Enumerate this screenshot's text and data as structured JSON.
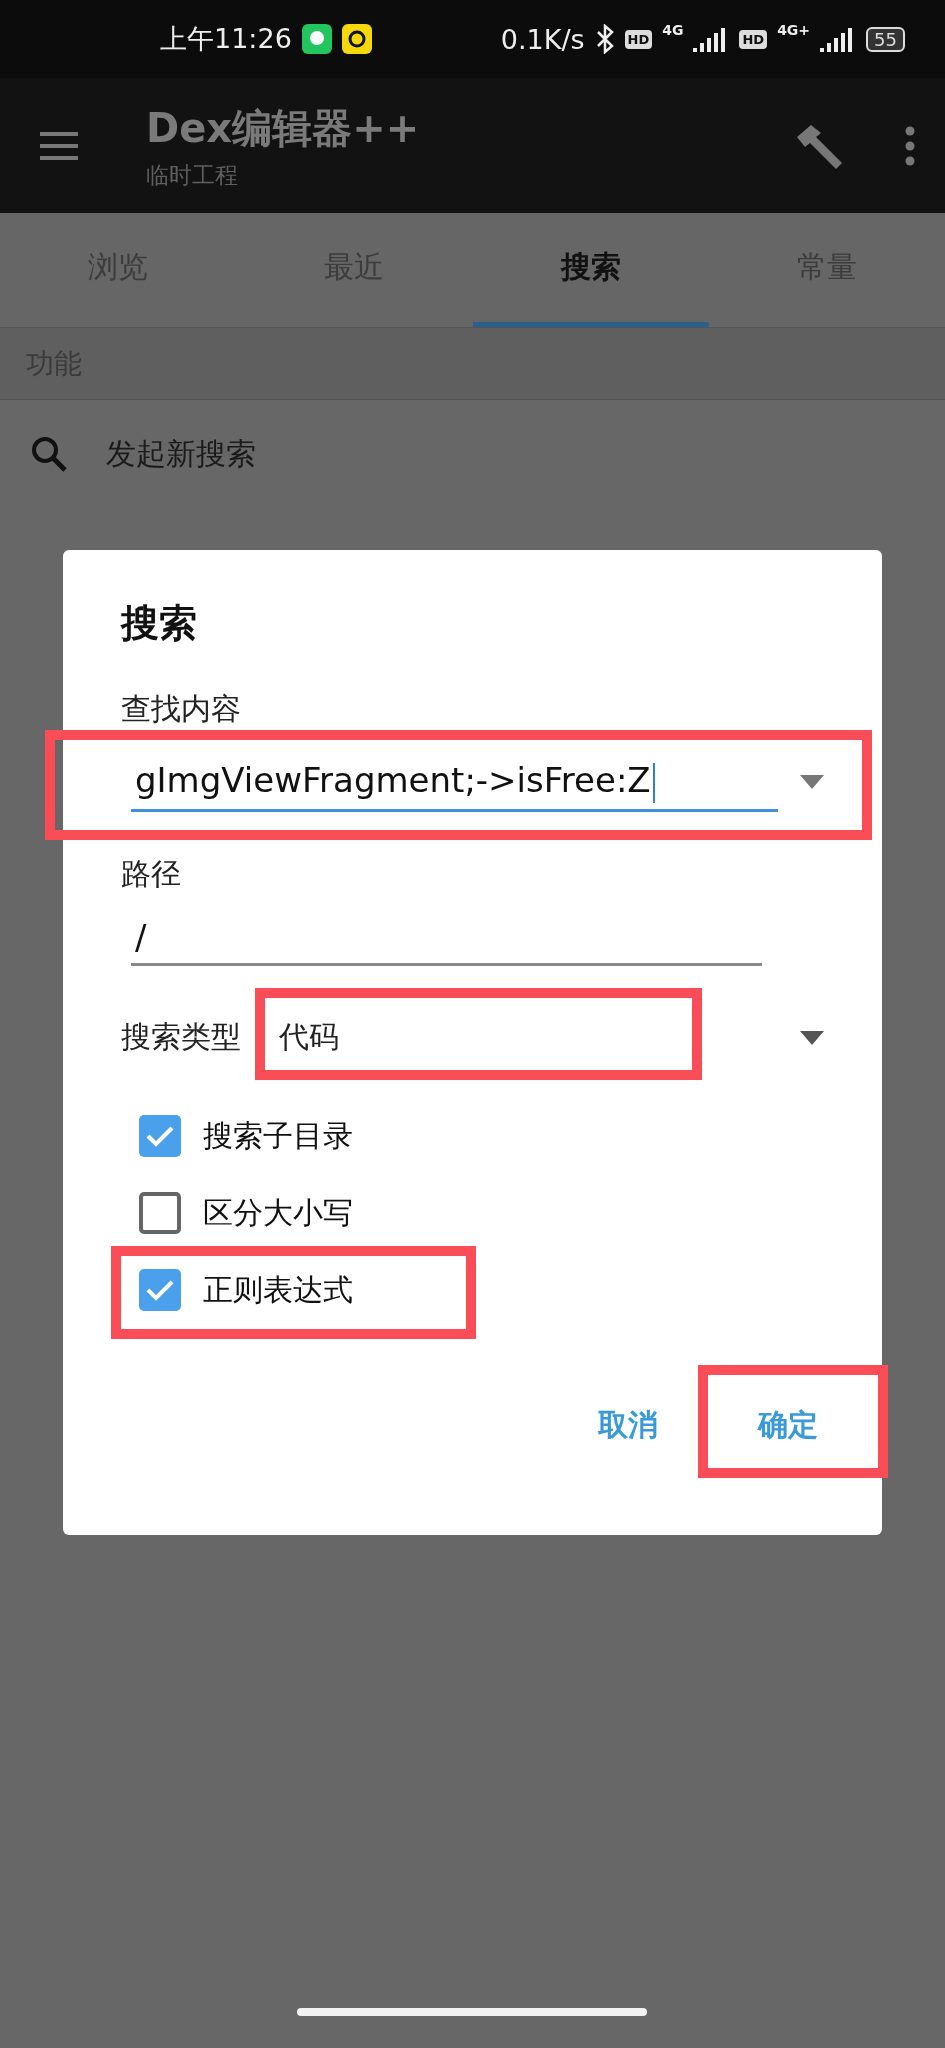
{
  "status_bar": {
    "time": "上午11:26",
    "speed": "0.1K/s",
    "sim_1": {
      "hd": "HD",
      "network": "4G"
    },
    "sim_2": {
      "hd": "HD",
      "network": "4G+"
    },
    "battery": "55"
  },
  "app_bar": {
    "title": "Dex编辑器++",
    "subtitle": "临时工程"
  },
  "tabs": [
    {
      "label": "浏览",
      "selected": false
    },
    {
      "label": "最近",
      "selected": false
    },
    {
      "label": "搜索",
      "selected": true
    },
    {
      "label": "常量",
      "selected": false
    }
  ],
  "section": {
    "header": "功能",
    "items": [
      {
        "label": "发起新搜索"
      }
    ]
  },
  "dialog": {
    "title": "搜索",
    "find_label": "查找内容",
    "find_value": "gImgViewFragment;->isFree:Z",
    "find_highlighted": true,
    "path_label": "路径",
    "path_value": "/",
    "type_label": "搜索类型",
    "type_value": "代码",
    "type_highlighted": true,
    "options": [
      {
        "label": "搜索子目录",
        "checked": true,
        "highlighted": false
      },
      {
        "label": "区分大小写",
        "checked": false,
        "highlighted": false
      },
      {
        "label": "正则表达式",
        "checked": true,
        "highlighted": true
      }
    ],
    "buttons": [
      {
        "label": "取消",
        "highlighted": false
      },
      {
        "label": "确定",
        "highlighted": true
      }
    ]
  }
}
